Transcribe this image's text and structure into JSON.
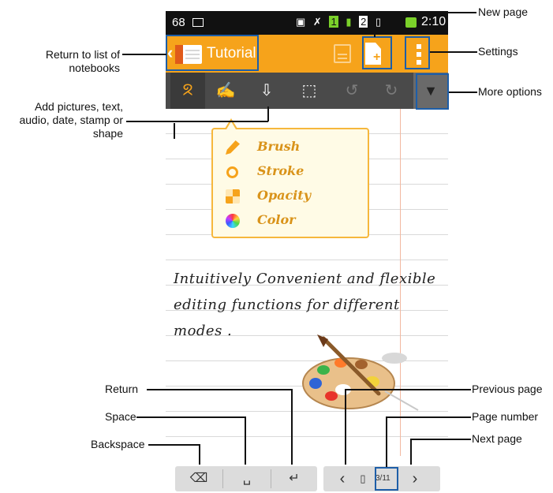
{
  "status_bar": {
    "left_text": "68",
    "time": "2:10",
    "sim_labels": [
      "1",
      "2"
    ]
  },
  "action_bar": {
    "back_glyph": "‹",
    "title": "Tutorial"
  },
  "toolbar": {
    "icons": [
      "brush-tool-icon",
      "text-style-icon",
      "insert-icon",
      "select-icon",
      "undo-icon",
      "redo-icon"
    ],
    "more_glyph": "▼"
  },
  "popup": {
    "items": [
      {
        "label": "Brush",
        "icon": "brush-icon"
      },
      {
        "label": "Stroke",
        "icon": "stroke-icon"
      },
      {
        "label": "Opacity",
        "icon": "opacity-icon"
      },
      {
        "label": "Color",
        "icon": "color-wheel-icon"
      }
    ]
  },
  "notes": {
    "lines": [
      "Intuitively Convenient and flexible",
      "editing functions for different",
      "modes ."
    ]
  },
  "bottom": {
    "page_number": "3/11",
    "prev_glyph": "‹",
    "next_glyph": "›"
  },
  "callouts": {
    "new_page": "New page",
    "settings": "Settings",
    "more_options": "More options",
    "return_list": "Return to list of notebooks",
    "add_content": "Add pictures, text, audio, date, stamp or shape",
    "return": "Return",
    "space": "Space",
    "backspace": "Backspace",
    "previous_page": "Previous page",
    "page_number": "Page number",
    "next_page": "Next page"
  },
  "colors": {
    "accent": "#f6a31b",
    "callout_box": "#1d5ea8",
    "toolbar_bg": "#4a4a4a"
  }
}
